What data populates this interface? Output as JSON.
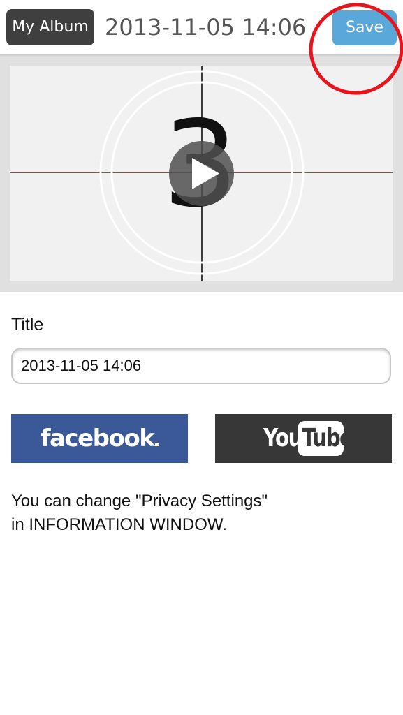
{
  "header": {
    "back_label": "My Album",
    "title": "2013-11-05 14:06",
    "save_label": "Save"
  },
  "video": {
    "countdown_digit": "3"
  },
  "form": {
    "title_label": "Title",
    "title_value": "2013-11-05 14:06"
  },
  "share": {
    "facebook_label": "facebook",
    "youtube_you": "You",
    "youtube_tube": "Tube"
  },
  "note": {
    "line1": "You can change \"Privacy Settings\"",
    "line2": "in INFORMATION WINDOW."
  },
  "colors": {
    "save_button": "#5aa8d9",
    "album_button": "#3f3f3f",
    "facebook": "#3b5998",
    "youtube": "#373737",
    "annotation_circle": "#e8141c"
  },
  "icons": {
    "play": "play-icon"
  }
}
